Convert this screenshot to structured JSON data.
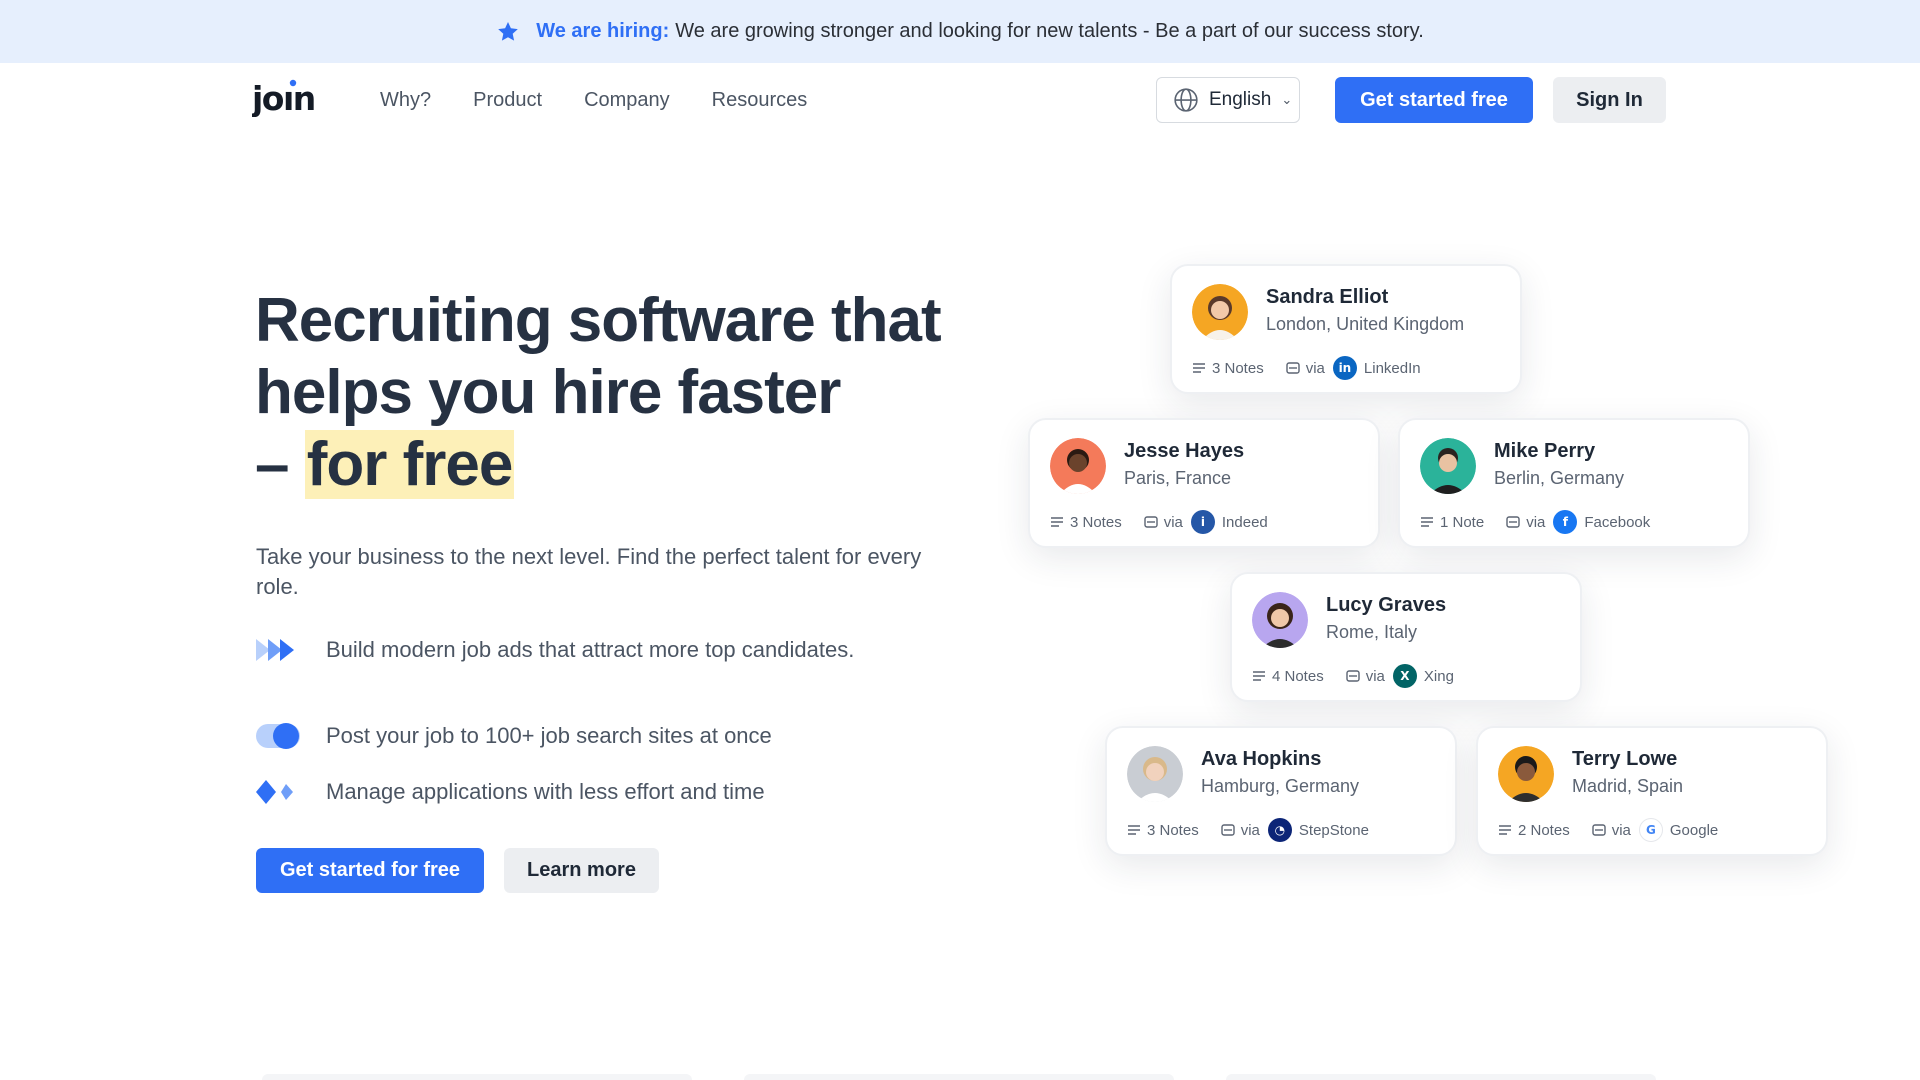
{
  "announcement": {
    "highlight": "We are hiring:",
    "text": "We are growing stronger and looking for new talents - Be a part of our success story."
  },
  "header": {
    "logo": "JOIN",
    "nav": [
      "Why?",
      "Product",
      "Company",
      "Resources"
    ],
    "language": "English",
    "cta_primary": "Get started free",
    "cta_secondary": "Sign In"
  },
  "hero": {
    "title_line1": "Recruiting software that",
    "title_line2": "helps you hire faster",
    "title_dash": "– ",
    "title_highlight": "for free",
    "subtitle": "Take your business to the next level. Find the perfect talent for every role.",
    "features": [
      "Build modern job ads that attract more top candidates.",
      "Post your job to 100+ job search sites at once",
      "Manage applications with less effort and time"
    ],
    "cta_primary": "Get started for free",
    "cta_secondary": "Learn more"
  },
  "candidates": [
    {
      "name": "Sandra Elliot",
      "location": "London, United Kingdom",
      "notes": "3 Notes",
      "via": "via",
      "source": "LinkedIn",
      "source_color": "#0a66c2",
      "avatar_bg": "#f5a623"
    },
    {
      "name": "Jesse Hayes",
      "location": "Paris, France",
      "notes": "3 Notes",
      "via": "via",
      "source": "Indeed",
      "source_color": "#2557a7",
      "avatar_bg": "#f47a5a"
    },
    {
      "name": "Mike Perry",
      "location": "Berlin, Germany",
      "notes": "1 Note",
      "via": "via",
      "source": "Facebook",
      "source_color": "#1877f2",
      "avatar_bg": "#2bb39a"
    },
    {
      "name": "Lucy Graves",
      "location": "Rome, Italy",
      "notes": "4 Notes",
      "via": "via",
      "source": "Xing",
      "source_color": "#026466",
      "avatar_bg": "#b8a6ef"
    },
    {
      "name": "Ava Hopkins",
      "location": "Hamburg, Germany",
      "notes": "3 Notes",
      "via": "via",
      "source": "StepStone",
      "source_color": "#0c2577",
      "avatar_bg": "#c9cdd3"
    },
    {
      "name": "Terry Lowe",
      "location": "Madrid, Spain",
      "notes": "2 Notes",
      "via": "via",
      "source": "Google",
      "source_color": "#ffffff",
      "avatar_bg": "#f5a623"
    }
  ],
  "colors": {
    "accent": "#2f6ff5",
    "announce_bg": "#e6effd",
    "highlight": "#fdf0b8",
    "heading": "#263142"
  }
}
